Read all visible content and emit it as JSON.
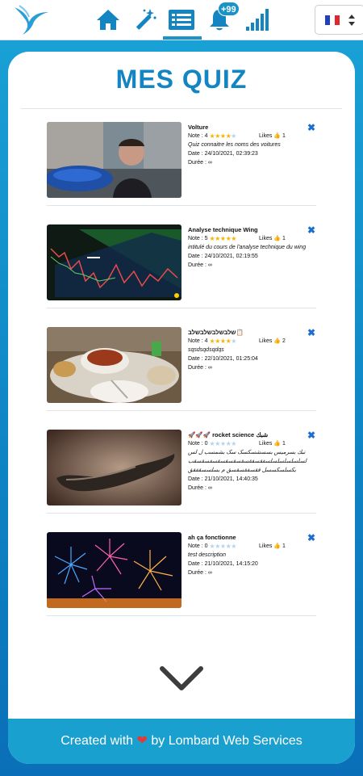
{
  "nav": {
    "notification_badge": "+99",
    "language_flag": "fr-flag-icon",
    "icons": [
      "bird-logo-icon",
      "home-icon",
      "magic-wand-icon",
      "quiz-list-icon",
      "bell-icon",
      "signal-bars-icon"
    ],
    "accent_color": "#1a93c6"
  },
  "page": {
    "title": "MES QUIZ"
  },
  "labels": {
    "note": "Note :",
    "likes": "Likes",
    "date": "Date :",
    "duration": "Durée :"
  },
  "quizzes": [
    {
      "title": "Volture",
      "rating": "4",
      "rating_value": 4,
      "likes": "1",
      "description": "Quiz connaitre les noms des voitures",
      "date": "24/10/2021, 02:39:23",
      "duration": "∞",
      "thumbnail": "car-selfie-photo"
    },
    {
      "title": "Analyse technique Wing",
      "rating": "5",
      "rating_value": 5,
      "likes": "1",
      "description": "intitulé du cours de l'analyse technique du wing",
      "date": "24/10/2021, 02:19:55",
      "duration": "∞",
      "thumbnail": "trading-chart-photo"
    },
    {
      "title": "שלבשלבשלבשלב📋",
      "rating": "4",
      "rating_value": 4,
      "likes": "2",
      "description": "sqsdsqdsqdqs",
      "date": "22/10/2021, 01:25:04",
      "duration": "∞",
      "thumbnail": "food-table-photo"
    },
    {
      "title": "🚀🚀🚀 rocket science شبك",
      "rating": "0",
      "rating_value": 0,
      "likes": "1",
      "description": "تبك بسرمیس بسسشسکسک سک بشمسب ل لس لسلسلسلسلسلسفقسفقسقسقسقسقسفسقسقب",
      "description2": "بکسلسکسسل فقسفقسقسق م بسلسسقفقق",
      "date": "21/10/2021, 14:40:35",
      "duration": "∞",
      "thumbnail": "sculpture-photo"
    },
    {
      "title": "ah ça fonctionne",
      "rating": "0",
      "rating_value": 0,
      "likes": "1",
      "description": "test description",
      "date": "21/10/2021, 14:15:20",
      "duration": "∞",
      "thumbnail": "fireworks-photo"
    }
  ],
  "footer": {
    "prefix": "Created with",
    "suffix": "by Lombard Web Services",
    "heart": "❤"
  }
}
